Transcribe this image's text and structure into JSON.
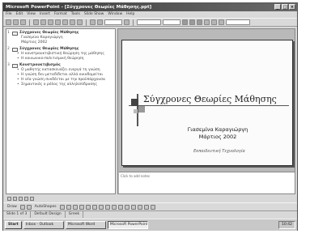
{
  "window": {
    "title": "Microsoft PowerPoint - [Σύγχρονες Θεωρίες Μάθησης.ppt]"
  },
  "menu": [
    "File",
    "Edit",
    "View",
    "Insert",
    "Format",
    "Tools",
    "Slide Show",
    "Window",
    "Help"
  ],
  "outline": {
    "slides": [
      {
        "num": "1",
        "title": "Σύγχρονες Θεωρίες Μάθησης",
        "lines": [
          "Γιασεμίνα Καραγιώργη",
          "Μάρτιος 2002"
        ]
      },
      {
        "num": "2",
        "title": "Σύγχρονες Θεωρίες Μάθησης",
        "bullets": [
          "Η κονστρουκτιβιστική θεώρηση της μάθησης",
          "Η κοινωνικο-πολιτισμική θεώρηση"
        ]
      },
      {
        "num": "3",
        "title": "Κονστρουκτιβισμός",
        "bullets": [
          "Ο μαθητής κατασκευάζει ενεργά τη γνώση",
          "Η γνώση δεν μεταδίδεται αλλά οικοδομείται",
          "Η νέα γνώση συνδέεται με την προϋπάρχουσα",
          "Σημαντικός ο ρόλος της αλληλεπίδρασης"
        ]
      }
    ]
  },
  "slide": {
    "title": "Σύγχρονες Θεωρίες  Μάθησης",
    "author": "Γιασεμίνα Καραγιώργη",
    "date": "Μάρτιος 2002",
    "subtitle": "Εκπαιδευτική Τεχνολογία"
  },
  "notes": {
    "placeholder": "Click to add notes"
  },
  "drawbar": {
    "draw_label": "Draw",
    "autoshapes_label": "AutoShapes"
  },
  "statusbar": {
    "slide": "Slide 1 of 3",
    "design": "Default Design",
    "language": "Greek"
  },
  "taskbar": {
    "start": "Start",
    "tasks": [
      "Inbox - Outlook",
      "Microsoft Word",
      "Microsoft PowerPoint"
    ],
    "clock": "10:42"
  }
}
